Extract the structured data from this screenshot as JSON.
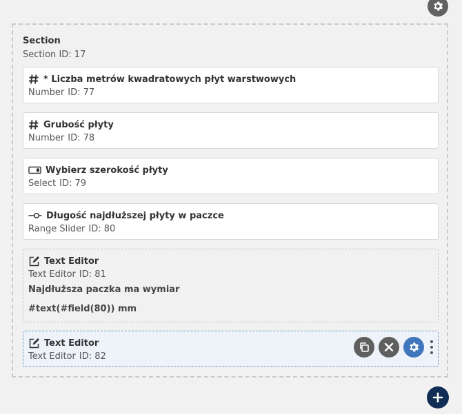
{
  "section": {
    "title": "Section",
    "type_label": "Section",
    "id_label": "ID: 17"
  },
  "fields": [
    {
      "icon": "hash-icon",
      "title": "* Liczba metrów kwadratowych płyt warstwowych",
      "type_label": "Number",
      "id_label": "ID: 77"
    },
    {
      "icon": "hash-icon",
      "title": "Grubość płyty",
      "type_label": "Number",
      "id_label": "ID: 78"
    },
    {
      "icon": "select-icon",
      "title": "Wybierz szerokość płyty",
      "type_label": "Select",
      "id_label": "ID: 79"
    },
    {
      "icon": "range-slider-icon",
      "title": "Długość najdłuższej płyty w paczce",
      "type_label": "Range Slider",
      "id_label": "ID: 80"
    },
    {
      "icon": "edit-icon",
      "title": "Text Editor",
      "type_label": "Text Editor",
      "id_label": "ID: 81",
      "content": [
        "Najdłuższa paczka ma wymiar",
        "#text(#field(80)) mm"
      ]
    },
    {
      "icon": "edit-icon",
      "title": "Text Editor",
      "type_label": "Text Editor",
      "id_label": "ID: 82",
      "selected": true
    }
  ],
  "actions": [
    "duplicate-icon",
    "close-icon",
    "gear-icon",
    "kebab-menu-icon"
  ],
  "colors": {
    "accent": "#3f76bd",
    "dark_button": "#5f5f5f",
    "add_button": "#0f2d55",
    "selected_bg": "#eef2f9",
    "selected_border": "#6f94c8"
  }
}
